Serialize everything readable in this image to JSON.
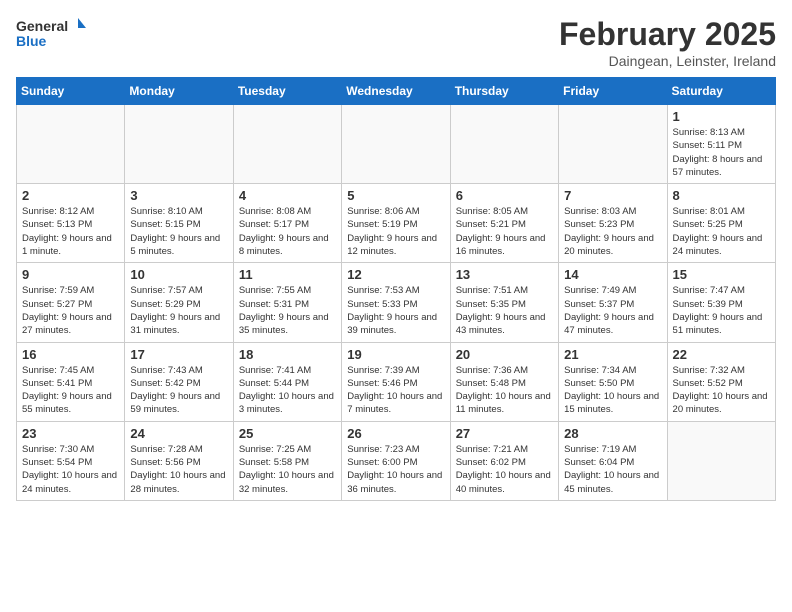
{
  "logo": {
    "general": "General",
    "blue": "Blue"
  },
  "header": {
    "month": "February 2025",
    "location": "Daingean, Leinster, Ireland"
  },
  "days_of_week": [
    "Sunday",
    "Monday",
    "Tuesday",
    "Wednesday",
    "Thursday",
    "Friday",
    "Saturday"
  ],
  "weeks": [
    [
      {
        "day": "",
        "info": ""
      },
      {
        "day": "",
        "info": ""
      },
      {
        "day": "",
        "info": ""
      },
      {
        "day": "",
        "info": ""
      },
      {
        "day": "",
        "info": ""
      },
      {
        "day": "",
        "info": ""
      },
      {
        "day": "1",
        "info": "Sunrise: 8:13 AM\nSunset: 5:11 PM\nDaylight: 8 hours and 57 minutes."
      }
    ],
    [
      {
        "day": "2",
        "info": "Sunrise: 8:12 AM\nSunset: 5:13 PM\nDaylight: 9 hours and 1 minute."
      },
      {
        "day": "3",
        "info": "Sunrise: 8:10 AM\nSunset: 5:15 PM\nDaylight: 9 hours and 5 minutes."
      },
      {
        "day": "4",
        "info": "Sunrise: 8:08 AM\nSunset: 5:17 PM\nDaylight: 9 hours and 8 minutes."
      },
      {
        "day": "5",
        "info": "Sunrise: 8:06 AM\nSunset: 5:19 PM\nDaylight: 9 hours and 12 minutes."
      },
      {
        "day": "6",
        "info": "Sunrise: 8:05 AM\nSunset: 5:21 PM\nDaylight: 9 hours and 16 minutes."
      },
      {
        "day": "7",
        "info": "Sunrise: 8:03 AM\nSunset: 5:23 PM\nDaylight: 9 hours and 20 minutes."
      },
      {
        "day": "8",
        "info": "Sunrise: 8:01 AM\nSunset: 5:25 PM\nDaylight: 9 hours and 24 minutes."
      }
    ],
    [
      {
        "day": "9",
        "info": "Sunrise: 7:59 AM\nSunset: 5:27 PM\nDaylight: 9 hours and 27 minutes."
      },
      {
        "day": "10",
        "info": "Sunrise: 7:57 AM\nSunset: 5:29 PM\nDaylight: 9 hours and 31 minutes."
      },
      {
        "day": "11",
        "info": "Sunrise: 7:55 AM\nSunset: 5:31 PM\nDaylight: 9 hours and 35 minutes."
      },
      {
        "day": "12",
        "info": "Sunrise: 7:53 AM\nSunset: 5:33 PM\nDaylight: 9 hours and 39 minutes."
      },
      {
        "day": "13",
        "info": "Sunrise: 7:51 AM\nSunset: 5:35 PM\nDaylight: 9 hours and 43 minutes."
      },
      {
        "day": "14",
        "info": "Sunrise: 7:49 AM\nSunset: 5:37 PM\nDaylight: 9 hours and 47 minutes."
      },
      {
        "day": "15",
        "info": "Sunrise: 7:47 AM\nSunset: 5:39 PM\nDaylight: 9 hours and 51 minutes."
      }
    ],
    [
      {
        "day": "16",
        "info": "Sunrise: 7:45 AM\nSunset: 5:41 PM\nDaylight: 9 hours and 55 minutes."
      },
      {
        "day": "17",
        "info": "Sunrise: 7:43 AM\nSunset: 5:42 PM\nDaylight: 9 hours and 59 minutes."
      },
      {
        "day": "18",
        "info": "Sunrise: 7:41 AM\nSunset: 5:44 PM\nDaylight: 10 hours and 3 minutes."
      },
      {
        "day": "19",
        "info": "Sunrise: 7:39 AM\nSunset: 5:46 PM\nDaylight: 10 hours and 7 minutes."
      },
      {
        "day": "20",
        "info": "Sunrise: 7:36 AM\nSunset: 5:48 PM\nDaylight: 10 hours and 11 minutes."
      },
      {
        "day": "21",
        "info": "Sunrise: 7:34 AM\nSunset: 5:50 PM\nDaylight: 10 hours and 15 minutes."
      },
      {
        "day": "22",
        "info": "Sunrise: 7:32 AM\nSunset: 5:52 PM\nDaylight: 10 hours and 20 minutes."
      }
    ],
    [
      {
        "day": "23",
        "info": "Sunrise: 7:30 AM\nSunset: 5:54 PM\nDaylight: 10 hours and 24 minutes."
      },
      {
        "day": "24",
        "info": "Sunrise: 7:28 AM\nSunset: 5:56 PM\nDaylight: 10 hours and 28 minutes."
      },
      {
        "day": "25",
        "info": "Sunrise: 7:25 AM\nSunset: 5:58 PM\nDaylight: 10 hours and 32 minutes."
      },
      {
        "day": "26",
        "info": "Sunrise: 7:23 AM\nSunset: 6:00 PM\nDaylight: 10 hours and 36 minutes."
      },
      {
        "day": "27",
        "info": "Sunrise: 7:21 AM\nSunset: 6:02 PM\nDaylight: 10 hours and 40 minutes."
      },
      {
        "day": "28",
        "info": "Sunrise: 7:19 AM\nSunset: 6:04 PM\nDaylight: 10 hours and 45 minutes."
      },
      {
        "day": "",
        "info": ""
      }
    ]
  ]
}
